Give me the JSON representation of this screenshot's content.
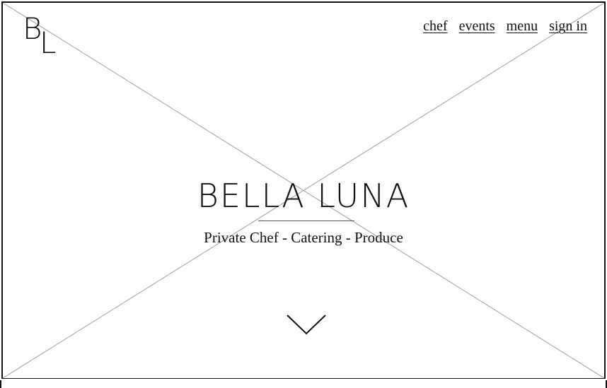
{
  "logo": {
    "letter_1": "B",
    "letter_2": "L"
  },
  "nav": {
    "items": [
      {
        "label": "chef"
      },
      {
        "label": "events"
      },
      {
        "label": "menu"
      },
      {
        "label": "sign in"
      }
    ]
  },
  "hero": {
    "title": "BELLA LUNA",
    "subtitle": "Private Chef - Catering - Produce"
  },
  "icons": {
    "scroll": "chevron-down-icon"
  },
  "colors": {
    "text": "#111111",
    "placeholder_lines": "#a0a0a0",
    "background": "#ffffff"
  }
}
